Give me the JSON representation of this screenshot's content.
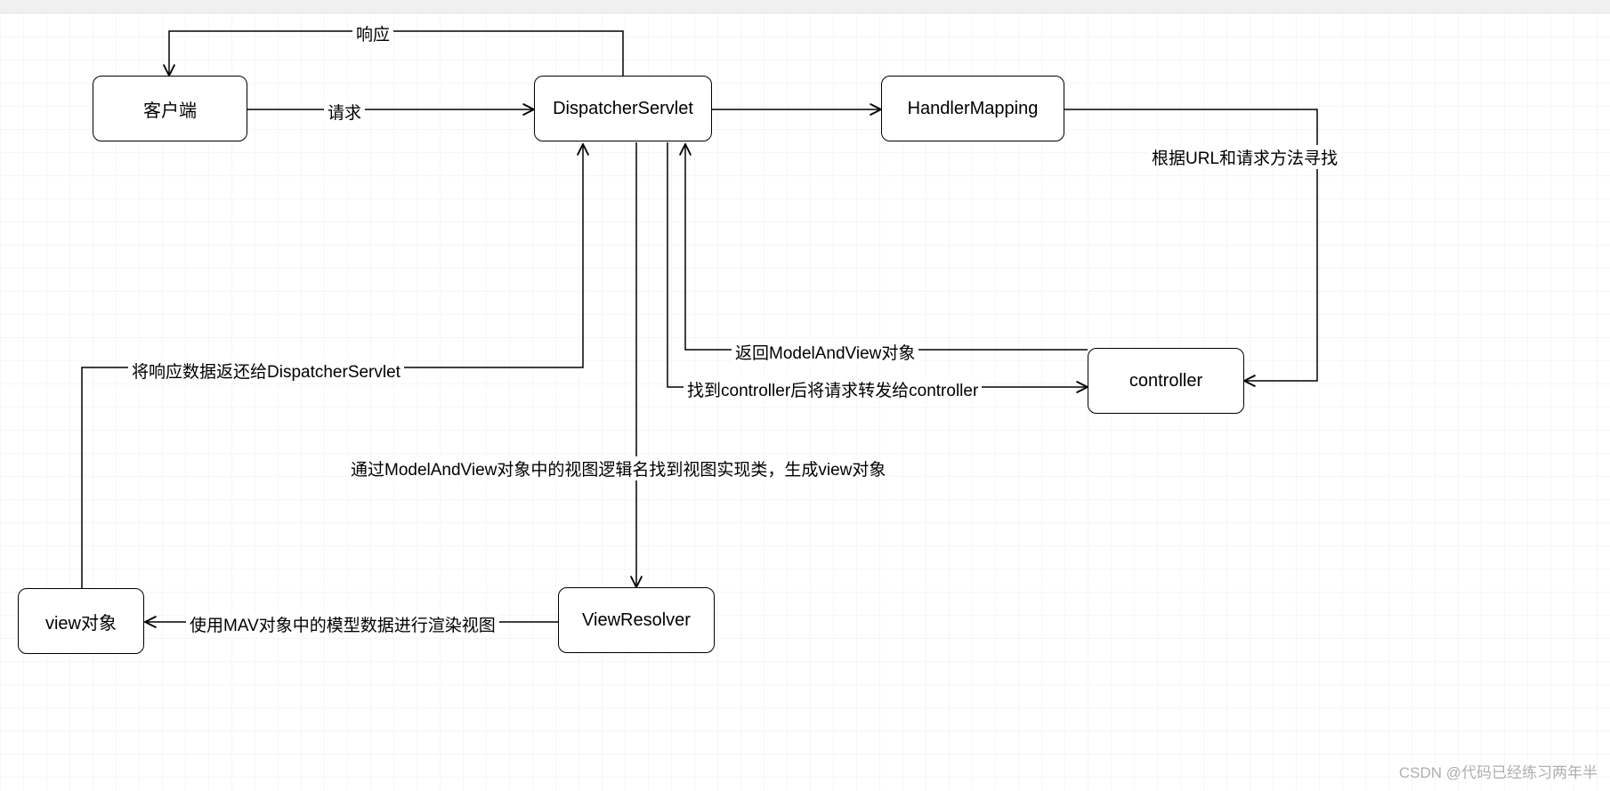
{
  "nodes": {
    "client": "客户端",
    "dispatcher": "DispatcherServlet",
    "handlerMapping": "HandlerMapping",
    "controller": "controller",
    "viewResolver": "ViewResolver",
    "viewObject": "view对象"
  },
  "edges": {
    "response": "响应",
    "request": "请求",
    "findByUrl": "根据URL和请求方法寻找",
    "returnMav": "返回ModelAndView对象",
    "forwardToController": "找到controller后将请求转发给controller",
    "mavToView": "通过ModelAndView对象中的视图逻辑名找到视图实现类，生成view对象",
    "renderView": "使用MAV对象中的模型数据进行渲染视图",
    "returnToDispatcher": "将响应数据返还给DispatcherServlet"
  },
  "watermark": "CSDN @代码已经练习两年半"
}
